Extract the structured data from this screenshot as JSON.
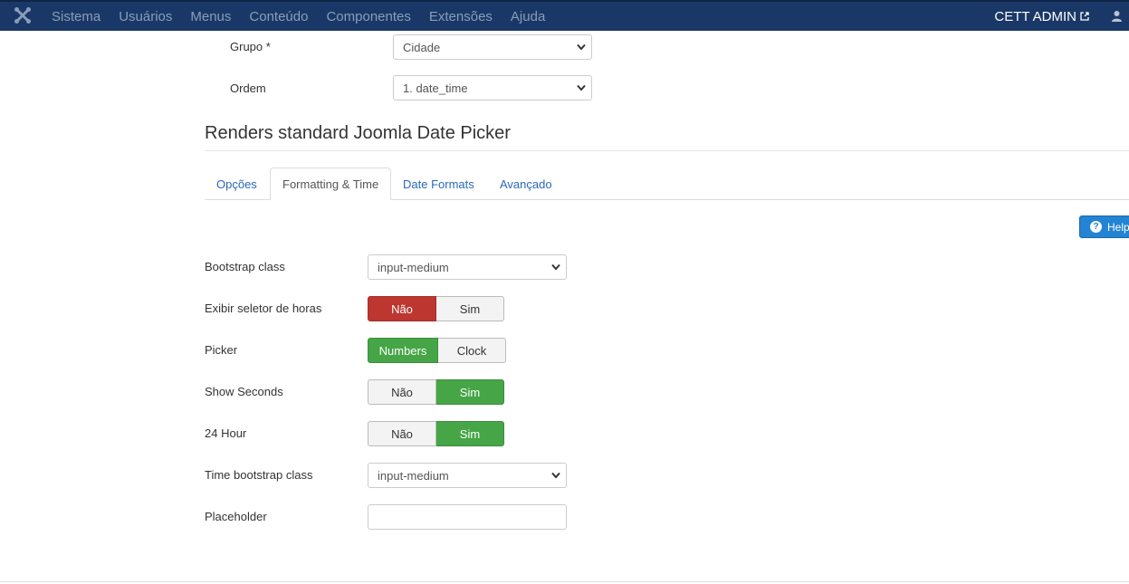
{
  "topbar": {
    "menu": [
      "Sistema",
      "Usuários",
      "Menus",
      "Conteúdo",
      "Componentes",
      "Extensões",
      "Ajuda"
    ],
    "admin_label": "CETT ADMIN",
    "icons": [
      "joomla-logo-icon",
      "external-link-icon",
      "user-icon"
    ]
  },
  "top_fields": {
    "grupo_label": "Grupo *",
    "grupo_value": "Cidade",
    "ordem_label": "Ordem",
    "ordem_value": "1. date_time"
  },
  "title": "Renders standard Joomla Date Picker",
  "tabs": [
    "Opções",
    "Formatting & Time",
    "Date Formats",
    "Avançado"
  ],
  "active_tab": "Formatting & Time",
  "help_label": "Help",
  "form": {
    "bootstrap_class": {
      "label": "Bootstrap class",
      "value": "input-medium"
    },
    "exibir_seletor": {
      "label": "Exibir seletor de horas",
      "options": [
        "Não",
        "Sim"
      ],
      "selected": "Não"
    },
    "picker": {
      "label": "Picker",
      "options": [
        "Numbers",
        "Clock"
      ],
      "selected": "Numbers"
    },
    "show_seconds": {
      "label": "Show Seconds",
      "options": [
        "Não",
        "Sim"
      ],
      "selected": "Sim"
    },
    "hour24": {
      "label": "24 Hour",
      "options": [
        "Não",
        "Sim"
      ],
      "selected": "Sim"
    },
    "time_bootstrap_class": {
      "label": "Time bootstrap class",
      "value": "input-medium"
    },
    "placeholder": {
      "label": "Placeholder",
      "value": ""
    }
  },
  "colors": {
    "topbar": "#1a3867",
    "danger": "#bd362f",
    "success": "#46a546",
    "link": "#2a69b8",
    "help": "#2384d3"
  }
}
